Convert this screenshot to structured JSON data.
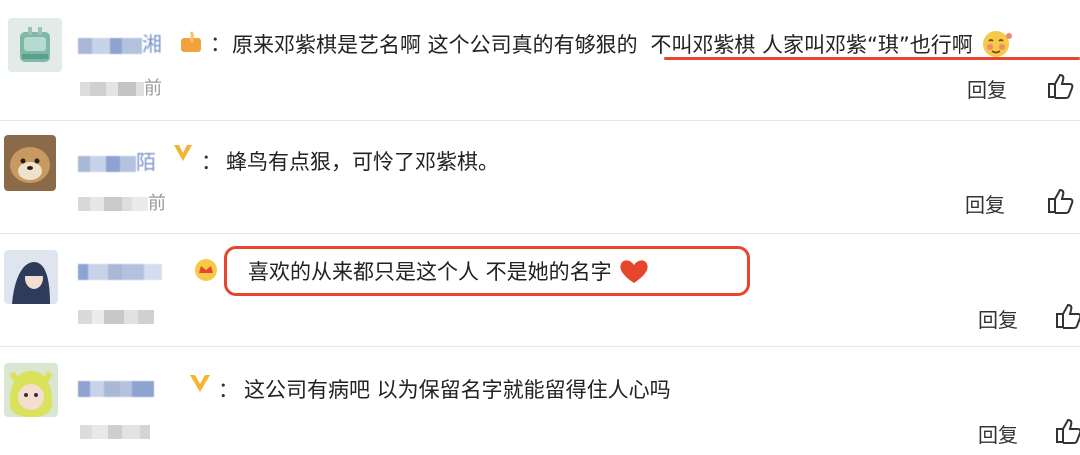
{
  "colors": {
    "username": "#7a93c8",
    "highlight": "#e8452d",
    "divider": "#e6e6e6"
  },
  "comments": [
    {
      "user_visible": "湘",
      "badge": "fire-badge-icon",
      "colon": "：",
      "text_main": "原来邓紫棋是艺名啊 这个公司真的有够狠的",
      "text_highlight": "不叫邓紫棋 人家叫邓紫“琪”也行啊",
      "emoji": "blush-emoji-icon",
      "time_visible": "前",
      "reply_label": "回复"
    },
    {
      "user_visible": "陌",
      "badge": "vip-v-badge-icon",
      "colon": "：",
      "text_main": "蜂鸟有点狠，可怜了邓紫棋。",
      "time_visible": "前",
      "reply_label": "回复"
    },
    {
      "user_visible": "",
      "badge": "crown-badge-icon",
      "colon": "：",
      "text_main": "喜欢的从来都只是这个人 不是她的名字",
      "emoji": "heart-icon",
      "time_visible": "",
      "reply_label": "回复"
    },
    {
      "user_visible": "",
      "badge": "v-badge-icon",
      "colon": "：",
      "text_main": "这公司有病吧 以为保留名字就能留得住人心吗",
      "time_visible": "",
      "reply_label": "回复"
    }
  ]
}
